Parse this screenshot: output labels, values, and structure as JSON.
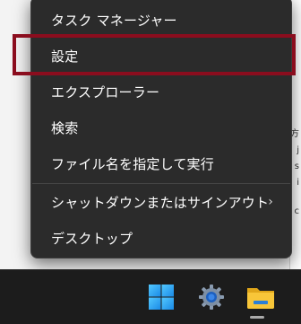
{
  "context_menu": {
    "items": [
      {
        "label": "タスク マネージャー"
      },
      {
        "label": "設定"
      },
      {
        "label": "エクスプローラー"
      },
      {
        "label": "検索"
      },
      {
        "label": "ファイル名を指定して実行"
      },
      {
        "label": "シャットダウンまたはサインアウト",
        "submenu_glyph": "›"
      },
      {
        "label": "デスクトップ"
      }
    ],
    "highlighted_item": "設定",
    "highlight_color": "#8b0d1e"
  },
  "background": {
    "side_glyphs": [
      "方",
      "j",
      "s",
      "i",
      "c"
    ]
  },
  "taskbar": {
    "icons": [
      "windows-start-icon",
      "settings-gear-icon",
      "file-explorer-folder-icon"
    ]
  }
}
